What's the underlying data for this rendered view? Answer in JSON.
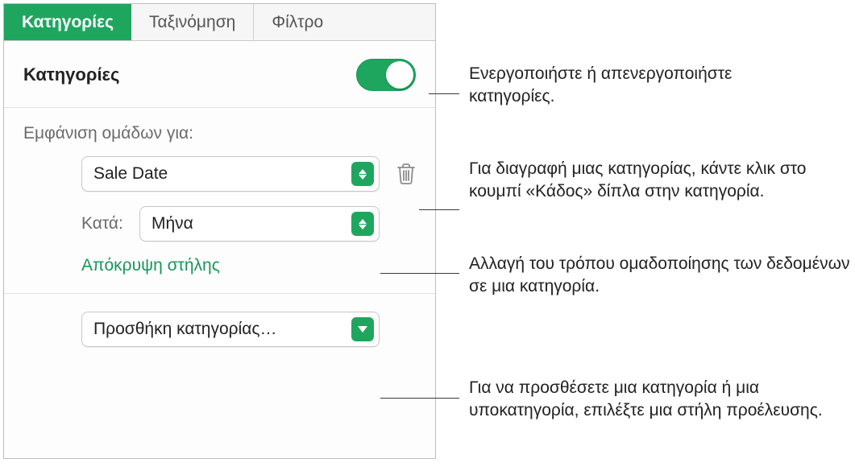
{
  "tabs": {
    "categories": "Κατηγορίες",
    "sort": "Ταξινόμηση",
    "filter": "Φίλτρο"
  },
  "section": {
    "title": "Κατηγορίες"
  },
  "groups": {
    "label": "Εμφάνιση ομάδων για:",
    "column_value": "Sale Date",
    "by_label": "Κατά:",
    "by_value": "Μήνα",
    "hide_column": "Απόκρυψη στήλης"
  },
  "add": {
    "label": "Προσθήκη κατηγορίας…"
  },
  "callouts": {
    "toggle": "Ενεργοποιήστε ή απενεργοποιήστε κατηγορίες.",
    "trash": "Για διαγραφή μιας κατηγορίας, κάντε κλικ στο κουμπί «Κάδος» δίπλα στην κατηγορία.",
    "grouping": "Αλλαγή του τρόπου ομαδοποίησης των δεδομένων σε μια κατηγορία.",
    "add": "Για να προσθέσετε μια κατηγορία ή μια υποκατηγορία, επιλέξτε μια στήλη προέλευσης."
  }
}
